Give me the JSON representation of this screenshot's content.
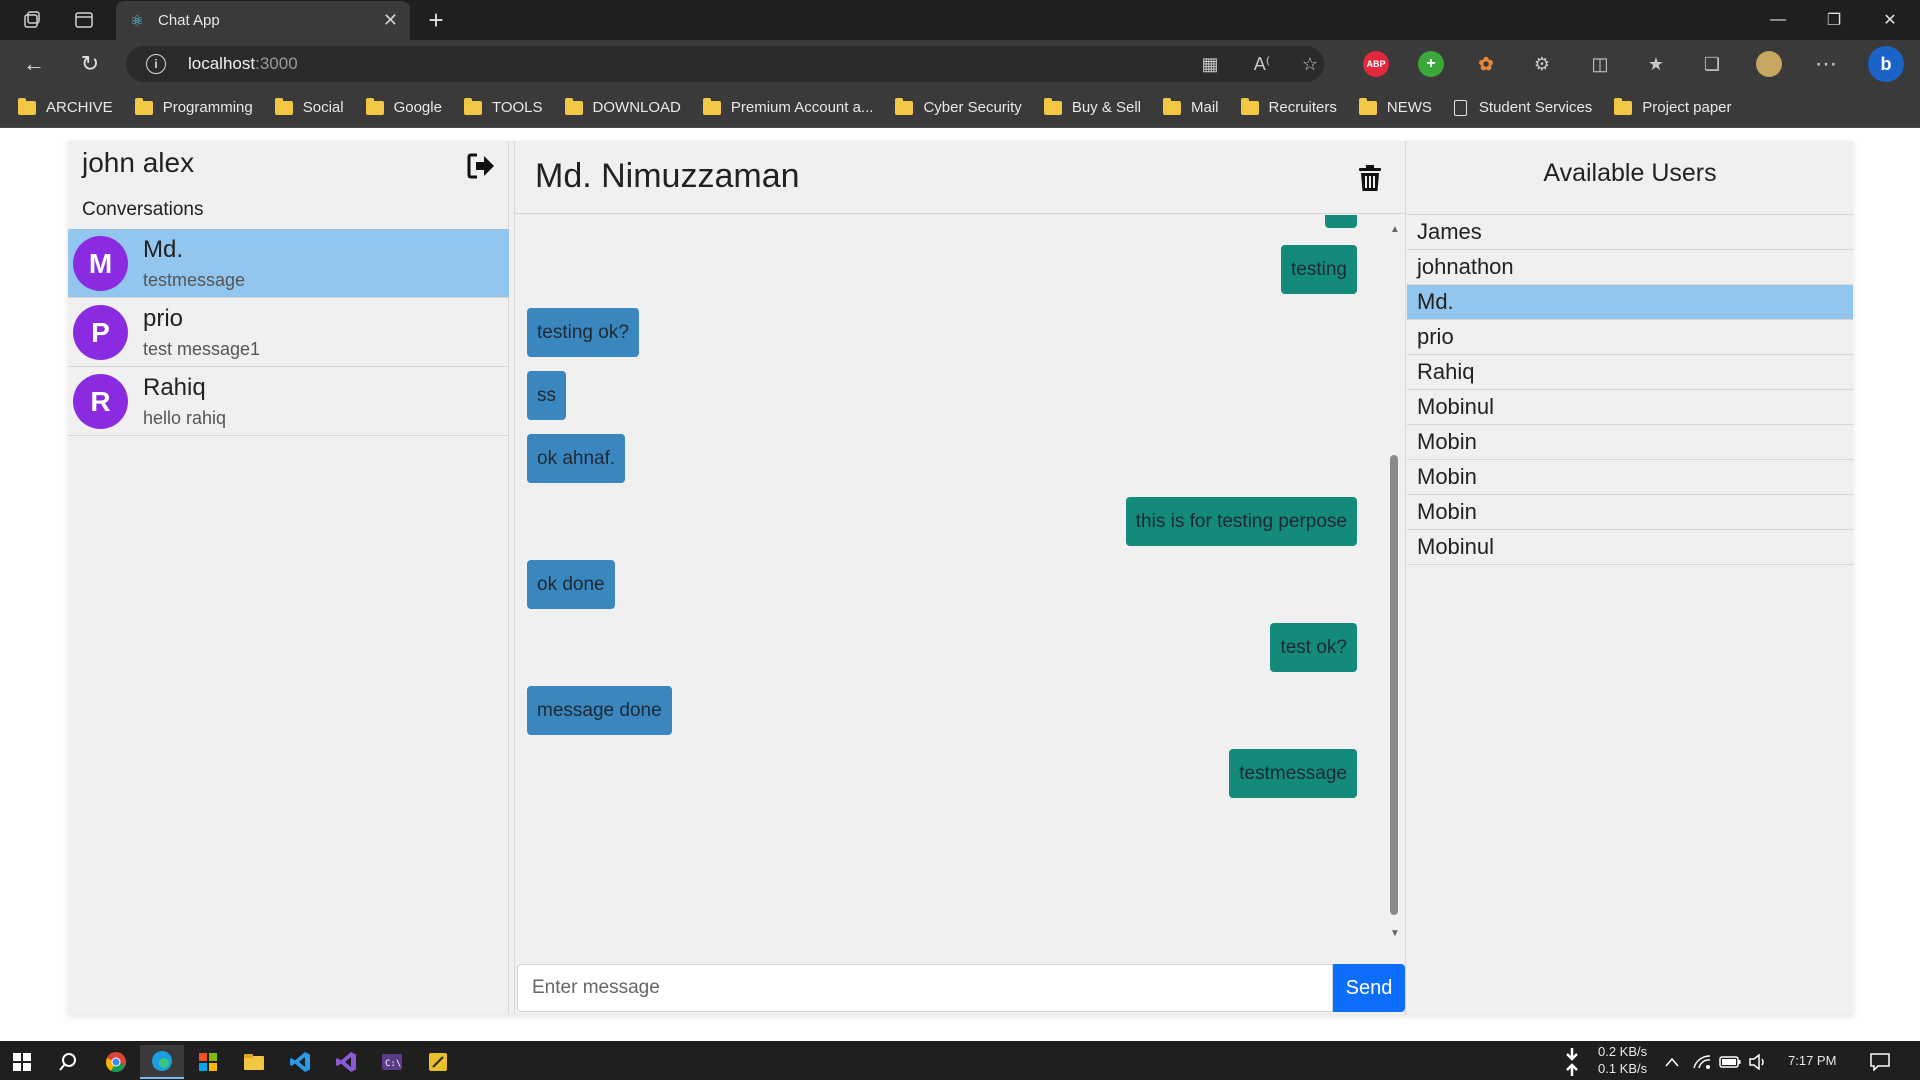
{
  "browser": {
    "tab_title": "Chat App",
    "url_host": "localhost",
    "url_port": ":3000",
    "extensions": {
      "abp": "ABP"
    },
    "bookmarks": [
      {
        "label": "ARCHIVE",
        "type": "folder"
      },
      {
        "label": "Programming",
        "type": "folder"
      },
      {
        "label": "Social",
        "type": "folder"
      },
      {
        "label": "Google",
        "type": "folder"
      },
      {
        "label": "TOOLS",
        "type": "folder"
      },
      {
        "label": "DOWNLOAD",
        "type": "folder"
      },
      {
        "label": "Premium Account a...",
        "type": "folder"
      },
      {
        "label": "Cyber Security",
        "type": "folder"
      },
      {
        "label": "Buy & Sell",
        "type": "folder"
      },
      {
        "label": "Mail",
        "type": "folder"
      },
      {
        "label": "Recruiters",
        "type": "folder"
      },
      {
        "label": "NEWS",
        "type": "folder"
      },
      {
        "label": "Student Services",
        "type": "page"
      },
      {
        "label": "Project paper",
        "type": "folder"
      }
    ]
  },
  "sidebar": {
    "current_user": "john alex",
    "conversations_heading": "Conversations",
    "conversations": [
      {
        "initial": "M",
        "name": "Md.",
        "preview": "testmessage",
        "active": true
      },
      {
        "initial": "P",
        "name": "prio",
        "preview": "test message1",
        "active": false
      },
      {
        "initial": "R",
        "name": "Rahiq",
        "preview": "hello rahiq",
        "active": false
      }
    ]
  },
  "chat": {
    "title": "Md. Nimuzzaman",
    "messages": [
      {
        "text": "testing",
        "direction": "out"
      },
      {
        "text": "testing ok?",
        "direction": "in"
      },
      {
        "text": "ss",
        "direction": "in"
      },
      {
        "text": "ok ahnaf.",
        "direction": "in"
      },
      {
        "text": "this is for testing perpose",
        "direction": "out"
      },
      {
        "text": "ok done",
        "direction": "in"
      },
      {
        "text": "test ok?",
        "direction": "out"
      },
      {
        "text": "message done",
        "direction": "in"
      },
      {
        "text": "testmessage",
        "direction": "out"
      }
    ],
    "input_placeholder": "Enter message",
    "send_label": "Send"
  },
  "users_panel": {
    "heading": "Available Users",
    "users": [
      {
        "name": "James",
        "active": false
      },
      {
        "name": "johnathon",
        "active": false
      },
      {
        "name": "Md.",
        "active": true
      },
      {
        "name": "prio",
        "active": false
      },
      {
        "name": "Rahiq",
        "active": false
      },
      {
        "name": "Mobinul",
        "active": false
      },
      {
        "name": "Mobin",
        "active": false
      },
      {
        "name": "Mobin",
        "active": false
      },
      {
        "name": "Mobin",
        "active": false
      },
      {
        "name": "Mobinul",
        "active": false
      }
    ]
  },
  "taskbar": {
    "net_down": "0.2 KB/s",
    "net_up": "0.1 KB/s",
    "time": "7:17 PM"
  },
  "colors": {
    "selected_row": "#93c6ee",
    "avatar": "#8a2be2",
    "incoming_bubble": "#3a86be",
    "outgoing_bubble": "#148a7a",
    "send_button": "#0d6efd"
  }
}
